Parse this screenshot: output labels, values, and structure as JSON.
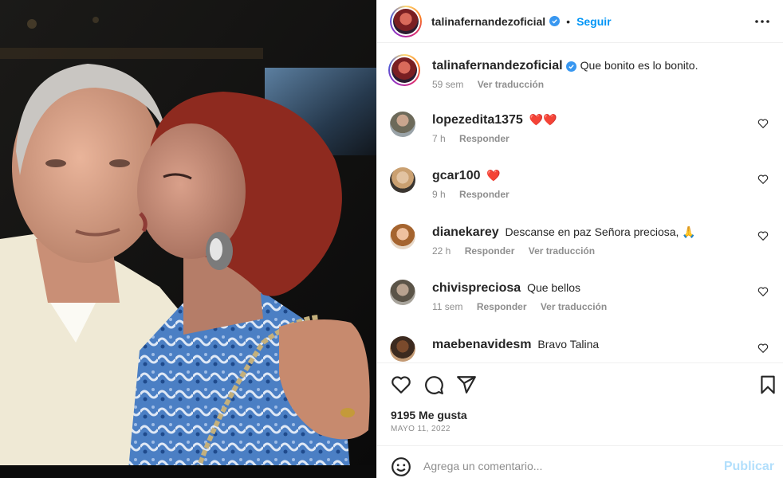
{
  "post": {
    "author": "talinafernandezoficial",
    "dot": "•",
    "follow_label": "Seguir",
    "caption": "Que bonito es lo bonito.",
    "caption_time": "59 sem",
    "caption_translate": "Ver traducción"
  },
  "comments": [
    {
      "user": "lopezedita1375",
      "text": "❤️❤️",
      "time": "7 h",
      "reply": "Responder",
      "translate": ""
    },
    {
      "user": "gcar100",
      "text": "❤️",
      "time": "9 h",
      "reply": "Responder",
      "translate": ""
    },
    {
      "user": "dianekarey",
      "text": "Descanse en paz Señora preciosa, 🙏",
      "time": "22 h",
      "reply": "Responder",
      "translate": "Ver traducción"
    },
    {
      "user": "chivispreciosa",
      "text": "Que bellos",
      "time": "11 sem",
      "reply": "Responder",
      "translate": "Ver traducción"
    },
    {
      "user": "maebenavidesm",
      "text": "Bravo Talina",
      "time": "",
      "reply": "",
      "translate": ""
    }
  ],
  "stats": {
    "likes": "9195 Me gusta",
    "date": "MAYO 11, 2022"
  },
  "compose": {
    "placeholder": "Agrega un comentario...",
    "publish_label": "Publicar"
  },
  "icons": {
    "more": "more-options-icon",
    "like": "heart-icon",
    "comment": "comment-icon",
    "share": "paper-plane-icon",
    "save": "bookmark-icon",
    "emoji": "emoji-icon",
    "verified": "verified-badge-icon"
  },
  "colors": {
    "accent": "#0095f6",
    "verified": "#3897f0",
    "muted": "#8e8e8e",
    "publish_disabled": "#b2dffc"
  }
}
